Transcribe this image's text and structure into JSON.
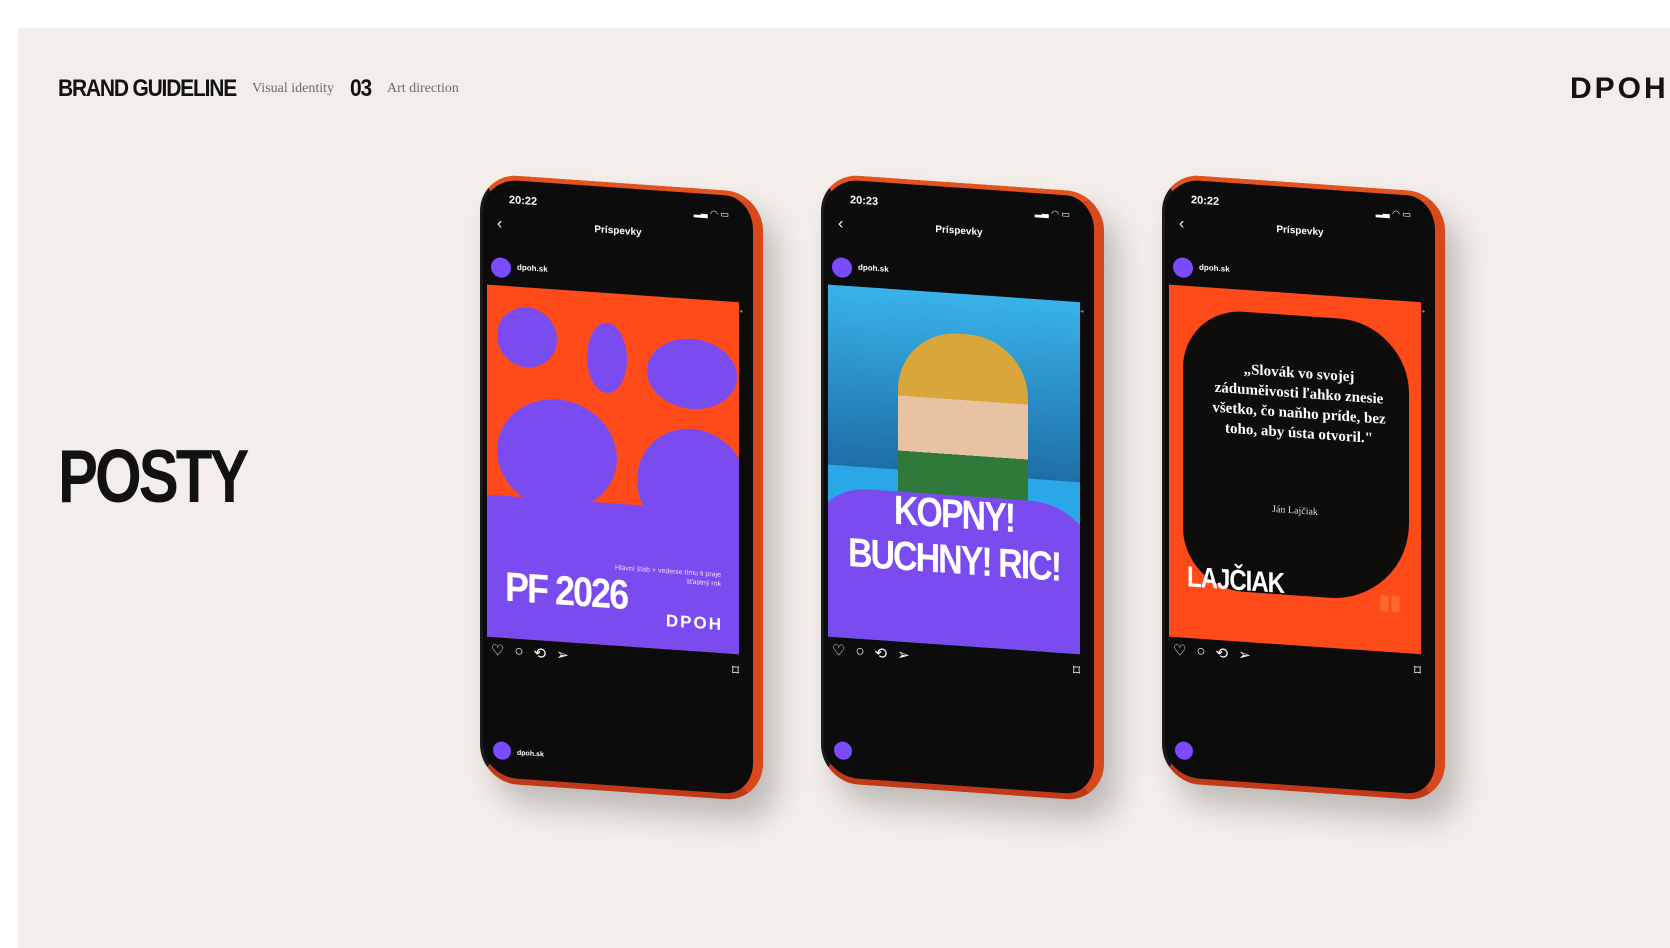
{
  "header": {
    "brand_guideline": "BRAND GUIDELINE",
    "section": "Visual identity",
    "number": "03",
    "subsection": "Art direction",
    "logo": "DPOH"
  },
  "title": "POSTY",
  "phones": [
    {
      "time": "20:22",
      "nav_title": "Príspevky",
      "account": "dpoh.sk",
      "post_title": "PF 2026",
      "post_subtitle": "Hlavní štáb + vedenie tímu ti praje šťastný rok",
      "post_logo": "DPOH",
      "comment_account": "dpoh.sk"
    },
    {
      "time": "20:23",
      "nav_title": "Príspevky",
      "account": "dpoh.sk",
      "post_title": "KOPNY! BUCHNY! RIC!"
    },
    {
      "time": "20:22",
      "nav_title": "Príspevky",
      "account": "dpoh.sk",
      "quote": "„Slovák vo svojej záduměivosti ľahko znesie všetko, čo naňho príde, bez toho, aby ústa otvoril.\"",
      "author": "Ján Lajčiak",
      "post_title": "LAJČIAK"
    }
  ],
  "colors": {
    "background": "#f3eeea",
    "orange": "#ff4a1a",
    "purple": "#7a4cf0",
    "black": "#0c0c0c"
  }
}
